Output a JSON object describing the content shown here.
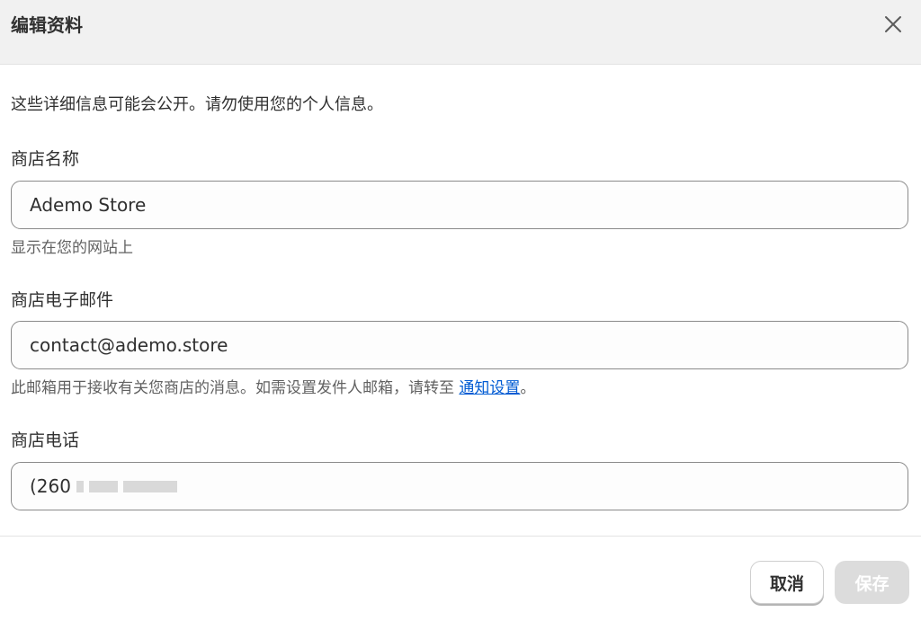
{
  "dialog": {
    "title": "编辑资料",
    "close_icon": "close-icon"
  },
  "notice": "这些详细信息可能会公开。请勿使用您的个人信息。",
  "store_name": {
    "label": "商店名称",
    "value": "Ademo Store",
    "help": "显示在您的网站上"
  },
  "store_email": {
    "label": "商店电子邮件",
    "value": "contact@ademo.store",
    "help_prefix": "此邮箱用于接收有关您商店的消息。如需设置发件人邮箱，请转至 ",
    "help_link": "通知设置",
    "help_suffix": "。"
  },
  "store_phone": {
    "label": "商店电话",
    "value_visible": "(260",
    "value_redacted": true
  },
  "footer": {
    "cancel_label": "取消",
    "save_label": "保存",
    "save_disabled": true
  },
  "colors": {
    "header_bg": "#f1f1f1",
    "link": "#005bd3",
    "text": "#303030",
    "muted": "#616161",
    "disabled_btn": "#dcdcdc"
  }
}
